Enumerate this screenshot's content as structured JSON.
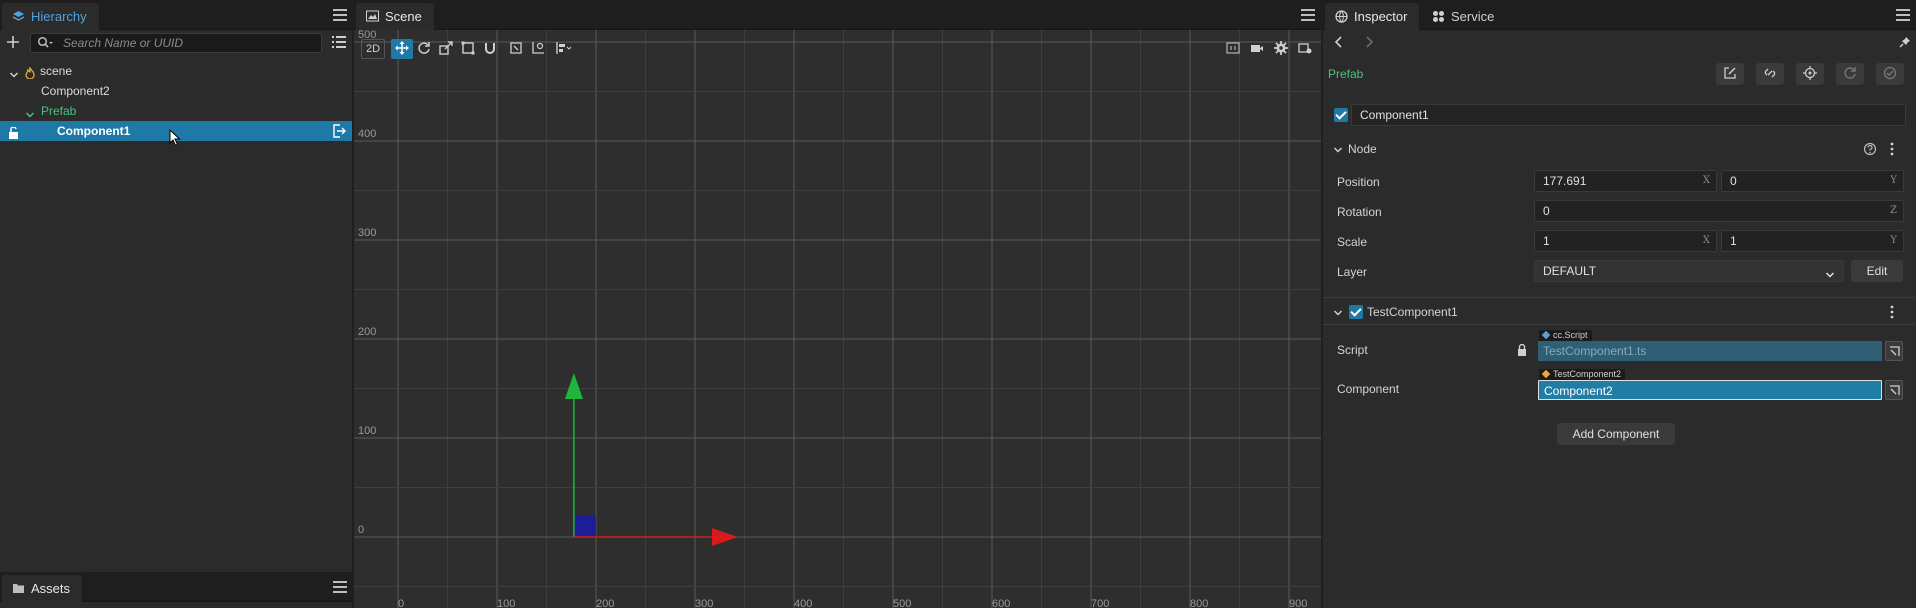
{
  "hierarchy": {
    "tab_label": "Hierarchy",
    "search_placeholder": "Search Name or UUID",
    "nodes": [
      {
        "label": "scene"
      },
      {
        "label": "Component2"
      },
      {
        "label": "Prefab"
      },
      {
        "label": "Component1"
      }
    ]
  },
  "assets": {
    "tab_label": "Assets"
  },
  "scene": {
    "tab_label": "Scene",
    "mode_label": "2D",
    "y_ticks": [
      "500",
      "400",
      "300",
      "200",
      "100",
      "0"
    ],
    "x_ticks": [
      "0",
      "100",
      "200",
      "300",
      "400",
      "500",
      "600",
      "700",
      "800",
      "900"
    ]
  },
  "inspector": {
    "tab_label": "Inspector",
    "service_tab_label": "Service",
    "prefab_label": "Prefab",
    "node_name": "Component1",
    "node_section": {
      "title": "Node",
      "position": {
        "label": "Position",
        "x": "177.691",
        "y": "0",
        "x_axis": "X",
        "y_axis": "Y"
      },
      "rotation": {
        "label": "Rotation",
        "value": "0",
        "axis": "Z"
      },
      "scale": {
        "label": "Scale",
        "x": "1",
        "y": "1",
        "x_axis": "X",
        "y_axis": "Y"
      },
      "layer": {
        "label": "Layer",
        "value": "DEFAULT",
        "edit_label": "Edit"
      }
    },
    "component_section": {
      "title": "TestComponent1",
      "script": {
        "label": "Script",
        "type_tag": "cc.Script",
        "value": "TestComponent1.ts"
      },
      "component": {
        "label": "Component",
        "type_tag": "TestComponent2",
        "value": "Component2"
      }
    },
    "add_component_label": "Add Component"
  },
  "colors": {
    "accent": "#1f79a6",
    "prefab_green": "#4ec07e",
    "axis_x": "#d91a1a",
    "axis_y": "#1fb53a",
    "node_rect": "#1a1aa8"
  }
}
